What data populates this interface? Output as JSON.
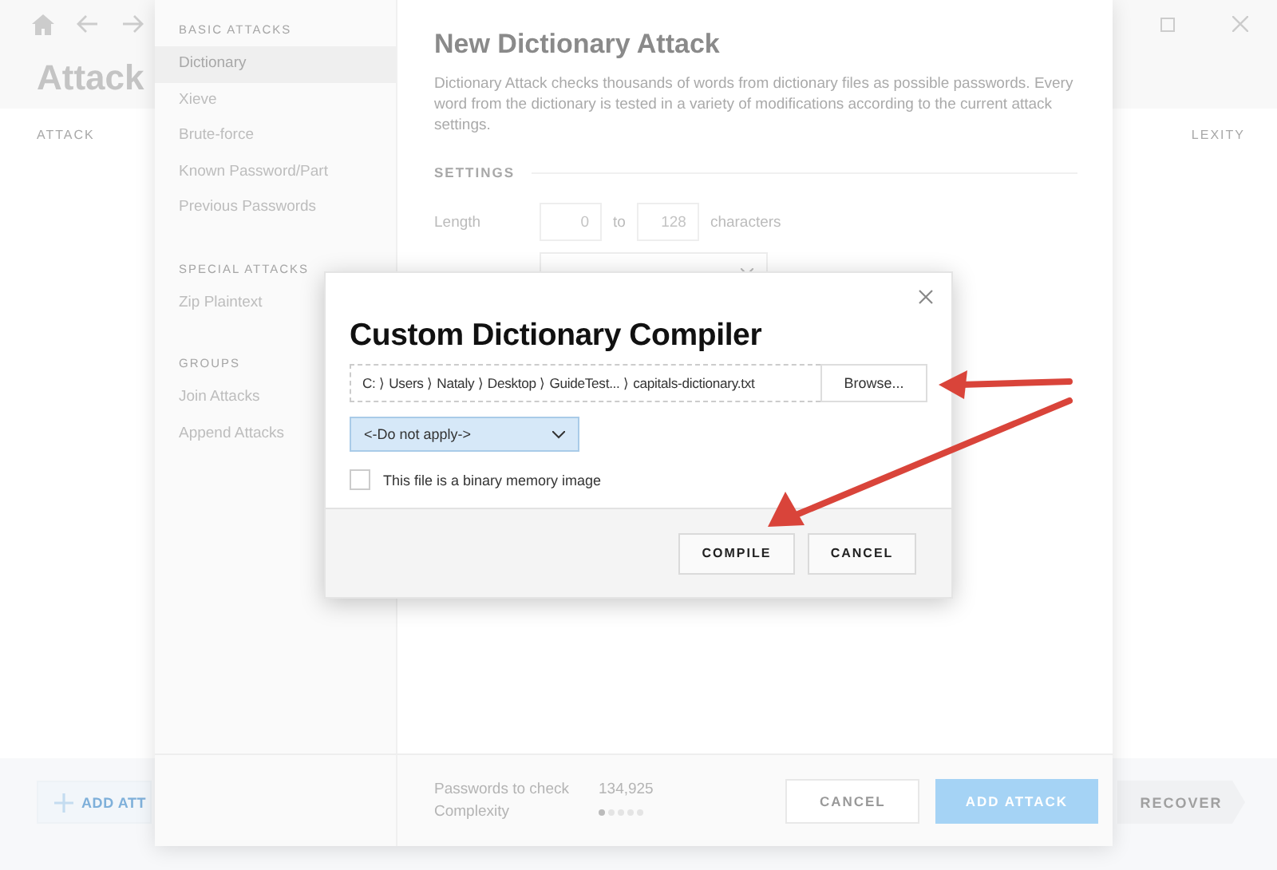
{
  "app": {
    "title": "Attack",
    "columns": [
      "ATTACK",
      "LEXITY"
    ],
    "add_button": "ADD ATT",
    "recover_button": "RECOVER"
  },
  "panel": {
    "sidebar": [
      {
        "heading": "BASIC ATTACKS",
        "items": [
          {
            "label": "Dictionary",
            "selected": true
          },
          {
            "label": "Xieve",
            "selected": false
          },
          {
            "label": "Brute-force",
            "selected": false
          },
          {
            "label": "Known Password/Part",
            "selected": false
          },
          {
            "label": "Previous Passwords",
            "selected": false
          }
        ]
      },
      {
        "heading": "SPECIAL ATTACKS",
        "items": [
          {
            "label": "Zip Plaintext",
            "selected": false
          }
        ]
      },
      {
        "heading": "GROUPS",
        "items": [
          {
            "label": "Join Attacks",
            "selected": false
          },
          {
            "label": "Append Attacks",
            "selected": false
          }
        ]
      }
    ],
    "title": "New Dictionary Attack",
    "description": "Dictionary Attack checks thousands of words from dictionary files as possible passwords. Every word from the dictionary is tested in a variety of modifications according to the current attack settings.",
    "settings": {
      "heading": "SETTINGS",
      "length": {
        "label": "Length",
        "from": "0",
        "separator": "to",
        "to": "128",
        "unit": "characters"
      }
    },
    "footer": {
      "passwords_label": "Passwords to check",
      "passwords_value": "134,925",
      "complexity_label": "Complexity",
      "complexity": {
        "level": 0.2
      },
      "buttons": [
        "CANCEL",
        "ADD ATTACK"
      ]
    }
  },
  "dialog": {
    "title": "Custom Dictionary Compiler",
    "path": "C: ⟩ Users ⟩ Nataly ⟩ Desktop ⟩ GuideTest... ⟩ capitals-dictionary.txt",
    "browse": "Browse...",
    "select": "<-Do not apply->",
    "checkbox": {
      "label": "This file is a binary memory image",
      "checked": false
    },
    "buttons": [
      "COMPILE",
      "CANCEL"
    ]
  }
}
